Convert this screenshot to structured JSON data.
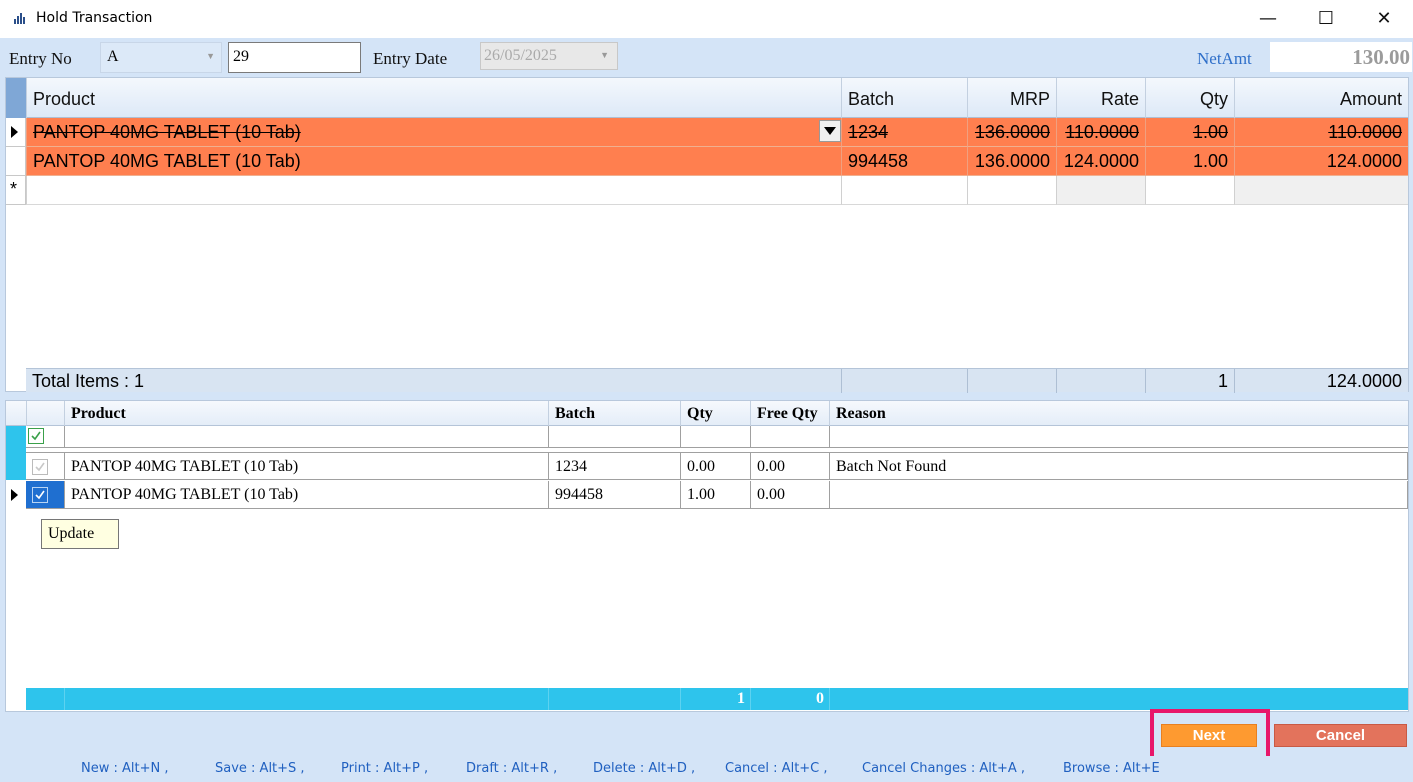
{
  "window": {
    "title": "Hold Transaction",
    "minimize": "—",
    "maximize": "☐",
    "close": "✕"
  },
  "header": {
    "entry_no_label": "Entry No",
    "entry_series": "A",
    "entry_number": "29",
    "entry_date_label": "Entry Date",
    "entry_date": "26/05/2025",
    "netamt_label": "NetAmt",
    "netamt_value": "130.00"
  },
  "items_grid": {
    "columns": [
      "Product",
      "Batch",
      "MRP",
      "Rate",
      "Qty",
      "Amount"
    ],
    "rows": [
      {
        "product": "PANTOP 40MG TABLET (10 Tab)",
        "batch": "1234",
        "mrp": "136.0000",
        "rate": "110.0000",
        "qty": "1.00",
        "amount": "110.0000"
      },
      {
        "product": "PANTOP 40MG TABLET (10 Tab)",
        "batch": "994458",
        "mrp": "136.0000",
        "rate": "124.0000",
        "qty": "1.00",
        "amount": "124.0000"
      }
    ],
    "new_row_marker": "*",
    "total_label": "Total Items : 1",
    "total_qty": "1",
    "total_amount": "124.0000"
  },
  "hold_grid": {
    "columns": [
      "Product",
      "Batch",
      "Qty",
      "Free Qty",
      "Reason"
    ],
    "rows": [
      {
        "product": "PANTOP 40MG TABLET (10 Tab)",
        "batch": "1234",
        "qty": "0.00",
        "free_qty": "0.00",
        "reason": "Batch Not Found"
      },
      {
        "product": "PANTOP 40MG TABLET (10 Tab)",
        "batch": "994458",
        "qty": "1.00",
        "free_qty": "0.00",
        "reason": ""
      }
    ],
    "footer_qty": "1",
    "footer_free_qty": "0",
    "tooltip": "Update"
  },
  "buttons": {
    "next": "Next",
    "cancel": "Cancel"
  },
  "shortcuts": [
    "New : Alt+N ,",
    "Save : Alt+S ,",
    "Print : Alt+P ,",
    "Draft : Alt+R ,",
    "Delete : Alt+D ,",
    "Cancel : Alt+C ,",
    "Cancel Changes : Alt+A ,",
    "Browse : Alt+E"
  ],
  "colors": {
    "row_highlight": "#ff7f4f",
    "header_bg": "#d4e4f7",
    "accent_cyan": "#2ec4ec",
    "next_button": "#fe9a30",
    "cancel_button": "#e3735c",
    "focus_outline": "#e8176a"
  }
}
